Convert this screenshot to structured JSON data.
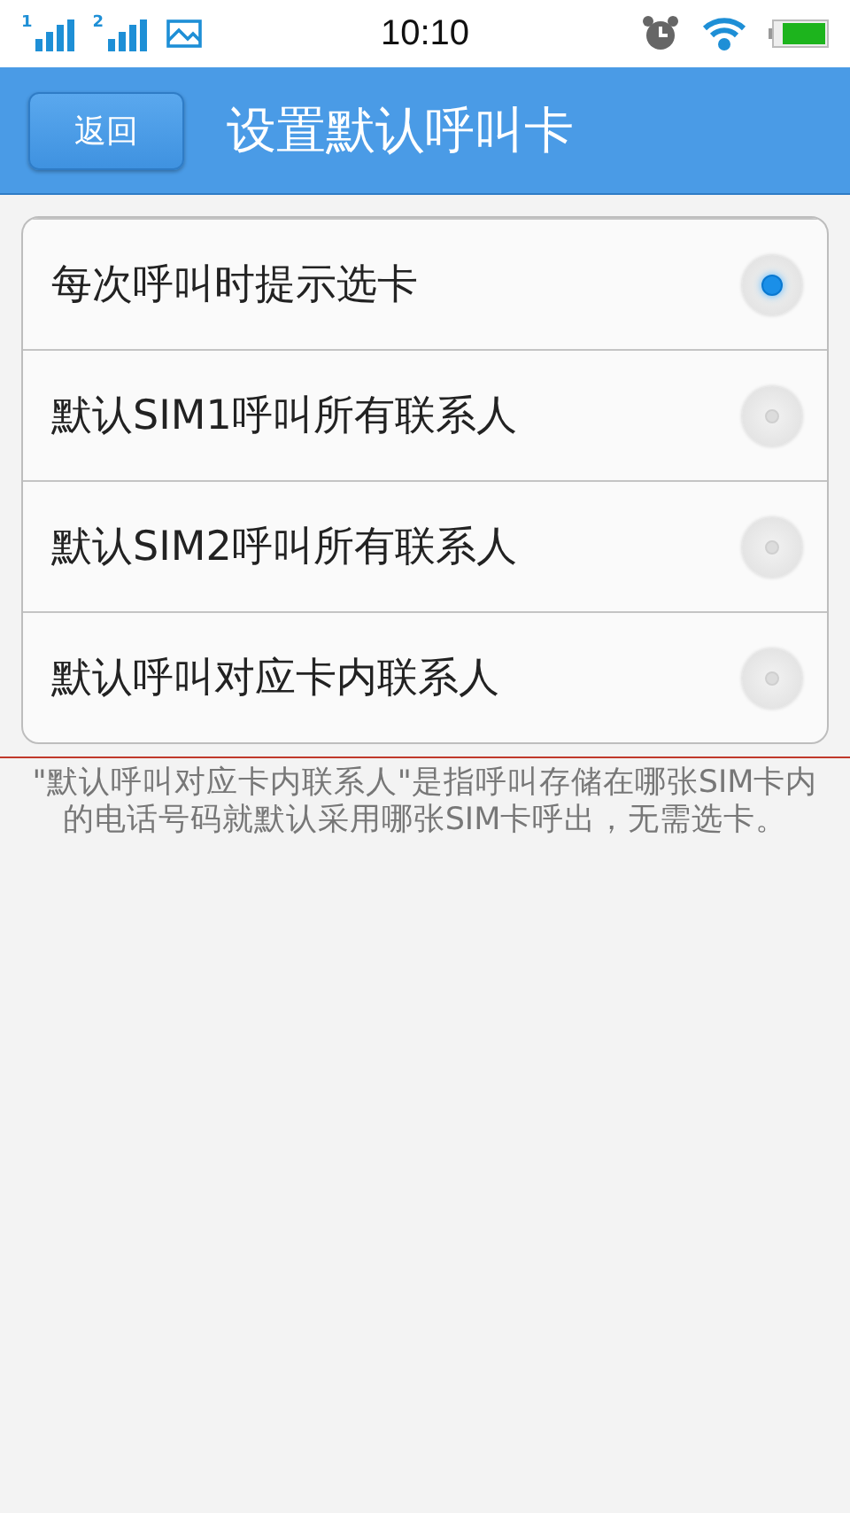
{
  "status_bar": {
    "sims": [
      "1",
      "2"
    ],
    "time": "10:10"
  },
  "header": {
    "back_button": "返回",
    "title": "设置默认呼叫卡"
  },
  "options": [
    {
      "label": "每次呼叫时提示选卡",
      "selected": true
    },
    {
      "label": "默认SIM1呼叫所有联系人",
      "selected": false
    },
    {
      "label": "默认SIM2呼叫所有联系人",
      "selected": false
    },
    {
      "label": "默认呼叫对应卡内联系人",
      "selected": false
    }
  ],
  "note": "\"默认呼叫对应卡内联系人\"是指呼叫存储在哪张SIM卡内的电话号码就默认采用哪张SIM卡呼出，无需选卡。"
}
